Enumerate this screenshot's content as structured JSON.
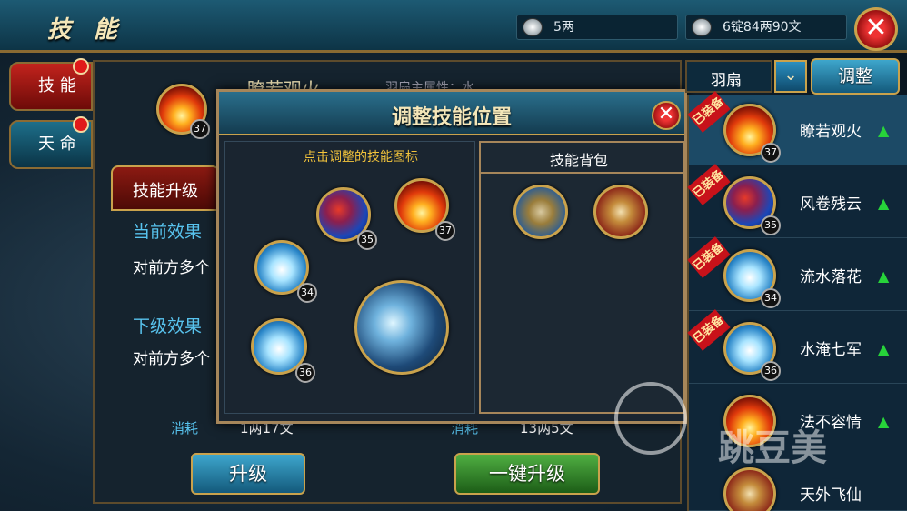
{
  "title": "技 能",
  "currency": [
    {
      "value": "5两"
    },
    {
      "value": "6锭84两90文"
    }
  ],
  "side_tabs": [
    {
      "label": "技 能"
    },
    {
      "label": "天 命"
    }
  ],
  "main": {
    "skill_name": "瞭若观火",
    "element_text": "羽扇主属性：水",
    "skill_level": "37",
    "upgrade_tab": "技能升级",
    "current_effect_label": "当前效果",
    "current_effect_text": "对前方多个",
    "next_effect_label": "下级效果",
    "next_effect_text": "对前方多个",
    "cost_label_1": "消耗",
    "cost_value_1": "1两17文",
    "cost_label_2": "消耗",
    "cost_value_2": "13两5文",
    "upgrade_button": "升级",
    "one_click_button": "一键升级"
  },
  "overlay": {
    "title": "调整技能位置",
    "left_hint": "点击调整的技能图标",
    "right_header": "技能背包",
    "slots": [
      {
        "level": "35"
      },
      {
        "level": "37"
      },
      {
        "level": "34"
      },
      {
        "level": "36"
      }
    ]
  },
  "right_panel": {
    "dropdown_value": "羽扇",
    "adjust_button": "调整",
    "equipped_ribbon": "已装备",
    "skills": [
      {
        "name": "瞭若观火",
        "level": "37"
      },
      {
        "name": "风卷残云",
        "level": "35"
      },
      {
        "name": "流水落花",
        "level": "34"
      },
      {
        "name": "水淹七军",
        "level": "36"
      },
      {
        "name": "法不容情"
      },
      {
        "name": "天外飞仙"
      }
    ]
  },
  "watermark": "跳豆美"
}
